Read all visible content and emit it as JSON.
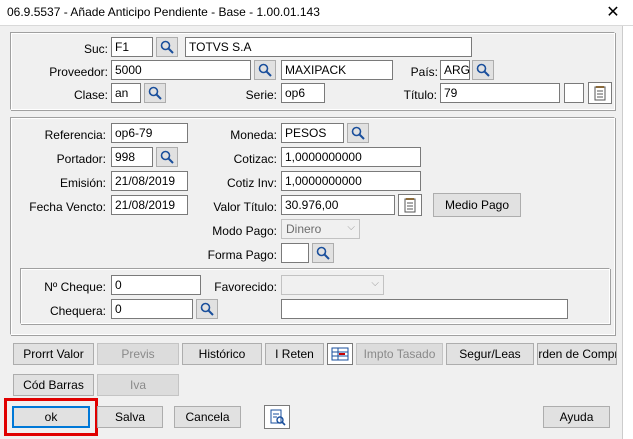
{
  "window": {
    "title": "06.9.5537 - Añade Anticipo Pendiente - Base - 1.00.01.143",
    "close_glyph": "✕"
  },
  "header": {
    "suc_label": "Suc:",
    "suc_value": "F1",
    "suc_name": "TOTVS S.A",
    "proveedor_label": "Proveedor:",
    "proveedor_value": "5000",
    "proveedor_name": "MAXIPACK",
    "pais_label": "País:",
    "pais_value": "ARG",
    "clase_label": "Clase:",
    "clase_value": "an",
    "serie_label": "Serie:",
    "serie_value": "op6",
    "titulo_label": "Título:",
    "titulo_value": "79",
    "titulo_extra": ""
  },
  "details": {
    "referencia_label": "Referencia:",
    "referencia_value": "op6-79",
    "moneda_label": "Moneda:",
    "moneda_value": "PESOS",
    "portador_label": "Portador:",
    "portador_value": "998",
    "cotizac_label": "Cotizac:",
    "cotizac_value": "1,0000000000",
    "emision_label": "Emisión:",
    "emision_value": "21/08/2019",
    "cotizinv_label": "Cotiz Inv:",
    "cotizinv_value": "1,0000000000",
    "vencto_label": "Fecha Vencto:",
    "vencto_value": "21/08/2019",
    "valor_label": "Valor Título:",
    "valor_value": "30.976,00",
    "medio_pago_button": "Medio Pago",
    "modo_pago_label": "Modo Pago:",
    "modo_pago_value": "Dinero",
    "forma_pago_label": "Forma Pago:",
    "forma_pago_value": "",
    "cheque_label": "Nº Cheque:",
    "cheque_value": "0",
    "favorecido_label": "Favorecido:",
    "favorecido_value": "",
    "chequera_label": "Chequera:",
    "chequera_value": "0",
    "chequera_desc": ""
  },
  "actions": {
    "prorrt_valor": "Prorrt Valor",
    "previs": "Previs",
    "historico": "Histórico",
    "ireten": "I Reten",
    "impto_tasado": "Impto Tasado",
    "segur_leas": "Segur/Leas",
    "orden_compra": "Orden de Compra",
    "cod_barras": "Cód Barras",
    "iva": "Iva"
  },
  "footer": {
    "ok": "ok",
    "salva": "Salva",
    "cancela": "Cancela",
    "ayuda": "Ayuda"
  },
  "icons": {
    "search": "magnifier-icon",
    "notes": "notepad-icon",
    "table": "tax-table-icon",
    "print": "document-lookup-icon"
  },
  "colors": {
    "highlight": "#e00000"
  }
}
